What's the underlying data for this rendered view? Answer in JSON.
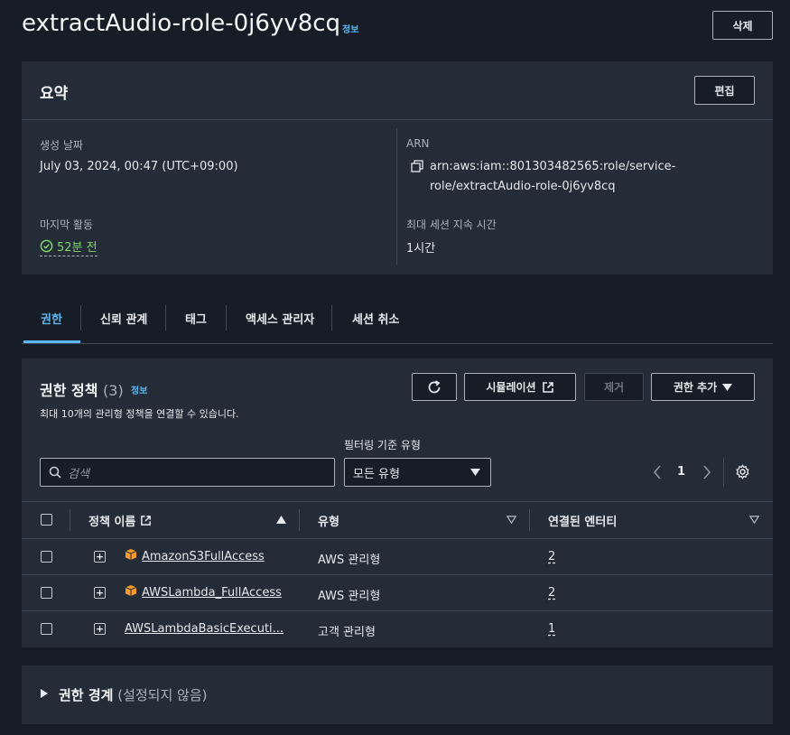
{
  "header": {
    "title": "extractAudio-role-0j6yv8cq",
    "info_label": "정보",
    "delete_label": "삭제"
  },
  "summary": {
    "title": "요약",
    "edit_label": "편집",
    "created_label": "생성 날짜",
    "created_value": "July 03, 2024, 00:47 (UTC+09:00)",
    "last_activity_label": "마지막 활동",
    "last_activity_value": "52분 전",
    "arn_label": "ARN",
    "arn_line1": "arn:aws:iam::801303482565:role/service-",
    "arn_line2": "role/extractAudio-role-0j6yv8cq",
    "max_session_label": "최대 세션 지속 시간",
    "max_session_value": "1시간"
  },
  "tabs": [
    {
      "label": "권한",
      "active": true
    },
    {
      "label": "신뢰 관계",
      "active": false
    },
    {
      "label": "태그",
      "active": false
    },
    {
      "label": "액세스 관리자",
      "active": false
    },
    {
      "label": "세션 취소",
      "active": false
    }
  ],
  "permissions": {
    "title": "권한 정책",
    "count": "(3)",
    "info_label": "정보",
    "subtitle": "최대 10개의 관리형 정책을 연결할 수 있습니다.",
    "simulate_label": "시뮬레이션",
    "remove_label": "제거",
    "add_label": "권한 추가",
    "filter_type_label": "필터링 기준 유형",
    "search_placeholder": "검색",
    "select_value": "모든 유형",
    "page_number": "1",
    "columns": {
      "name": "정책 이름",
      "type": "유형",
      "entities": "연결된 엔터티"
    },
    "rows": [
      {
        "name": "AmazonS3FullAccess",
        "type": "AWS 관리형",
        "entities": "2",
        "aws_icon": true
      },
      {
        "name": "AWSLambda_FullAccess",
        "type": "AWS 관리형",
        "entities": "2",
        "aws_icon": true
      },
      {
        "name": "AWSLambdaBasicExecuti...",
        "type": "고객 관리형",
        "entities": "1",
        "aws_icon": false
      }
    ]
  },
  "boundary": {
    "title": "권한 경계",
    "status": "(설정되지 않음)"
  },
  "colors": {
    "background": "#161d26",
    "panel": "#232c37",
    "accent": "#5eb7f0",
    "success": "#7fd36b",
    "aws_orange": "#f79a2b"
  }
}
